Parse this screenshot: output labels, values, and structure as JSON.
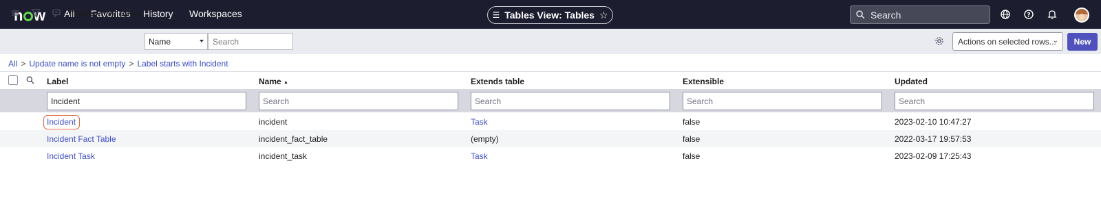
{
  "topnav": {
    "logo_text": "now",
    "links": [
      "All",
      "Favorites",
      "History",
      "Workspaces"
    ],
    "context_pill": "Tables View: Tables",
    "search_placeholder": "Search",
    "icons": [
      "globe-icon",
      "help-icon",
      "bell-icon",
      "user-avatar"
    ]
  },
  "toolbar": {
    "title": "Tables",
    "view_label": "View: Tables",
    "field_select": "Name",
    "search_placeholder": "Search",
    "actions_select": "Actions on selected rows...",
    "new_label": "New"
  },
  "breadcrumb": {
    "items": [
      "All",
      "Update name is not empty",
      "Label starts with Incident"
    ],
    "separator": ">"
  },
  "table": {
    "columns": [
      "Label",
      "Name",
      "Extends table",
      "Extensible",
      "Updated"
    ],
    "sort_indicator": "▲",
    "filters": {
      "label_value": "Incident",
      "placeholder": "Search"
    },
    "rows": [
      {
        "label": "Incident",
        "name": "incident",
        "extends": "Task",
        "extensible": "false",
        "updated": "2023-02-10 10:47:27"
      },
      {
        "label": "Incident Fact Table",
        "name": "incident_fact_table",
        "extends": "(empty)",
        "extensible": "false",
        "updated": "2022-03-17 19:57:53"
      },
      {
        "label": "Incident Task",
        "name": "incident_task",
        "extends": "Task",
        "extensible": "false",
        "updated": "2023-02-09 17:25:43"
      }
    ]
  },
  "colors": {
    "nav_bg": "#1c1d2e",
    "accent": "#4f52bd",
    "link": "#3b4cc6",
    "logo_ring": "#62d84e",
    "highlight": "#e06a47"
  }
}
